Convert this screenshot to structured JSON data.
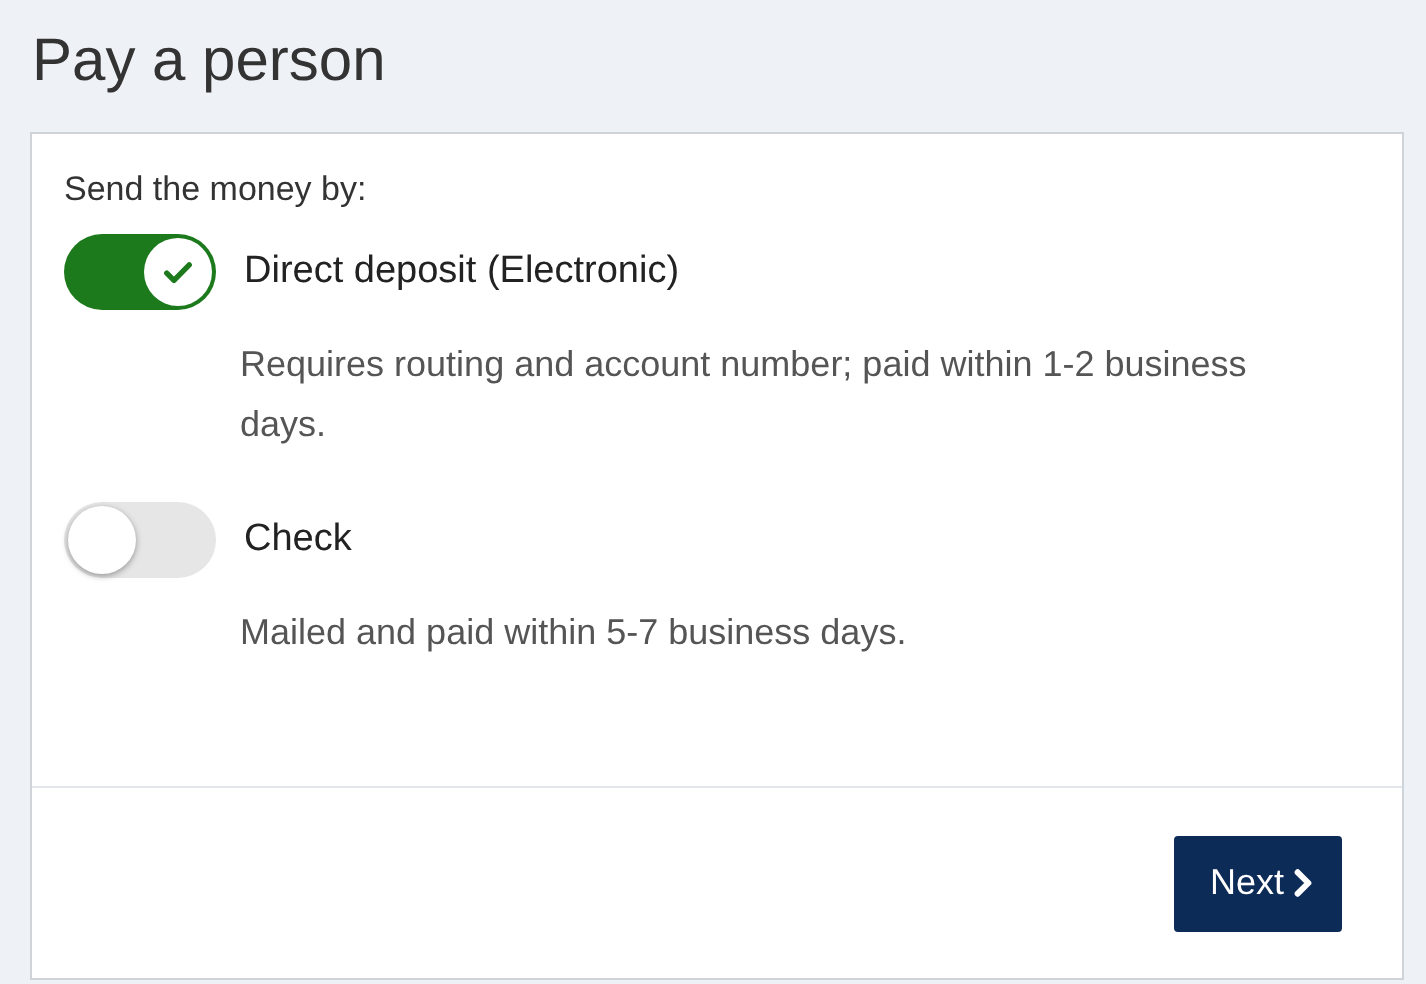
{
  "title": "Pay a person",
  "prompt": "Send the money by:",
  "options": [
    {
      "label": "Direct deposit (Electronic)",
      "description": "Requires routing and account number; paid within 1-2 business days.",
      "selected": true
    },
    {
      "label": "Check",
      "description": "Mailed and paid within 5-7 business days.",
      "selected": false
    }
  ],
  "next_button": "Next"
}
